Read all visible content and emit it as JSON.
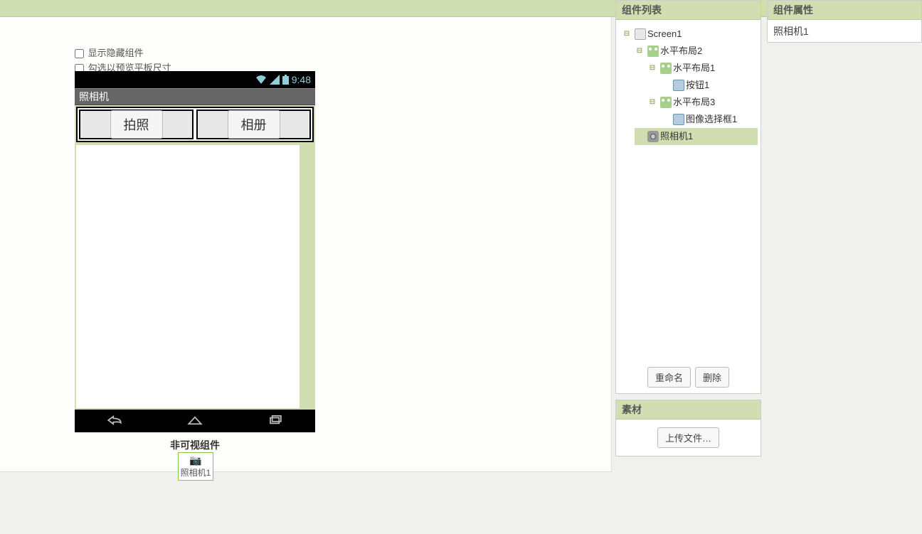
{
  "workspace": {
    "show_hidden_label": "显示隐藏组件",
    "tablet_preview_label": "勾选以预览平板尺寸",
    "phone": {
      "time": "9:48",
      "app_title": "照相机",
      "button1_label": "拍照",
      "button2_label": "相册"
    },
    "nonvisible_section_label": "非可视组件",
    "nonvisible_item": "照相机1"
  },
  "components": {
    "panel_title": "组件列表",
    "tree": {
      "root": "Screen1",
      "h2": "水平布局2",
      "h1": "水平布局1",
      "btn1": "按钮1",
      "h3": "水平布局3",
      "imgpick1": "图像选择框1",
      "camera1": "照相机1"
    },
    "rename_btn": "重命名",
    "delete_btn": "删除"
  },
  "media": {
    "panel_title": "素材",
    "upload_btn": "上传文件…"
  },
  "properties": {
    "panel_title": "组件属性",
    "selected_name": "照相机1"
  }
}
